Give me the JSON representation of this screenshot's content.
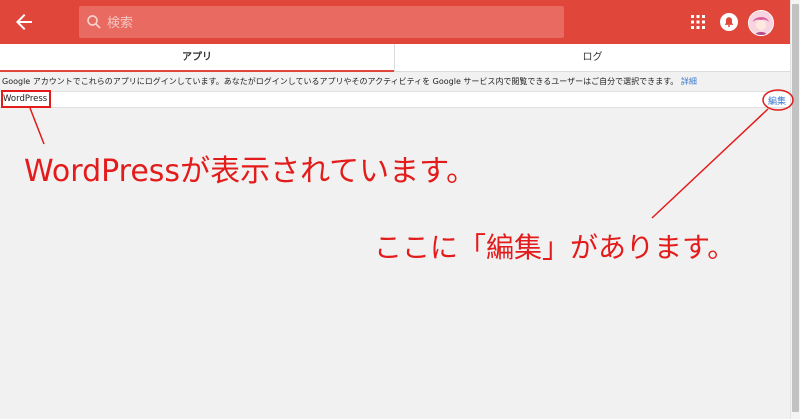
{
  "header": {
    "search_placeholder": "検索"
  },
  "tabs": [
    {
      "label": "アプリ"
    },
    {
      "label": "ログ"
    }
  ],
  "info": {
    "text": "Google アカウントでこれらのアプリにログインしています。あなたがログインしているアプリやそのアクティビティを Google サービス内で閲覧できるユーザーはご自分で選択できます。",
    "link": "詳細"
  },
  "apps": [
    {
      "name": "WordPress",
      "edit": "編集"
    }
  ],
  "annotations": {
    "wordpress_note": "WordPressが表示されています。",
    "edit_note": "ここに「編集」があります。"
  },
  "colors": {
    "header": "#e0463a",
    "annotation": "#e31b1b",
    "link": "#3b78c9"
  }
}
